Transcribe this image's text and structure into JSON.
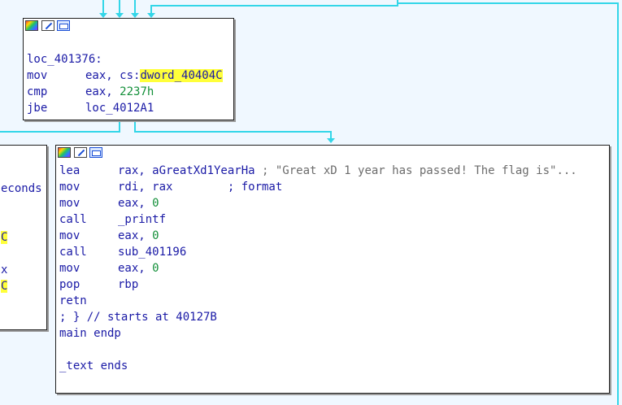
{
  "colors": {
    "background": "#f0f8ff",
    "edge": "#33d6e8",
    "highlight": "#ffff3a",
    "text": "#1a1aa6",
    "number": "#14903a",
    "comment": "#6c6c6c"
  },
  "toolbar_icons": [
    "color-palette-icon",
    "edit-node-icon",
    "graph-overview-icon"
  ],
  "node_top": {
    "label": "loc_401376:",
    "ins1": {
      "mn": "mov",
      "op": "eax, cs:",
      "sym": "dword_40404C"
    },
    "ins2": {
      "mn": "cmp",
      "op": "eax, ",
      "num": "2237h"
    },
    "ins3": {
      "mn": "jbe",
      "op": "loc_4012A1"
    }
  },
  "node_left": {
    "frag1": "econds",
    "frag2": "C",
    "frag3": "x",
    "frag4": "C"
  },
  "node_main": {
    "l1": {
      "mn": "lea",
      "op": "rax, aGreatXd1YearHa ",
      "cm": "; \"Great xD 1 year has passed! The flag is\"..."
    },
    "l2": {
      "mn": "mov",
      "op": "rdi, rax        ",
      "cm": "; format"
    },
    "l3": {
      "mn": "mov",
      "op": "eax, ",
      "num": "0"
    },
    "l4": {
      "mn": "call",
      "op": "_printf"
    },
    "l5": {
      "mn": "mov",
      "op": "eax, ",
      "num": "0"
    },
    "l6": {
      "mn": "call",
      "op": "sub_401196"
    },
    "l7": {
      "mn": "mov",
      "op": "eax, ",
      "num": "0"
    },
    "l8": {
      "mn": "pop",
      "op": "rbp"
    },
    "l9": {
      "mn": "retn"
    },
    "l10": "; } // starts at 40127B",
    "l11": "main endp",
    "l12": "_text ends"
  }
}
